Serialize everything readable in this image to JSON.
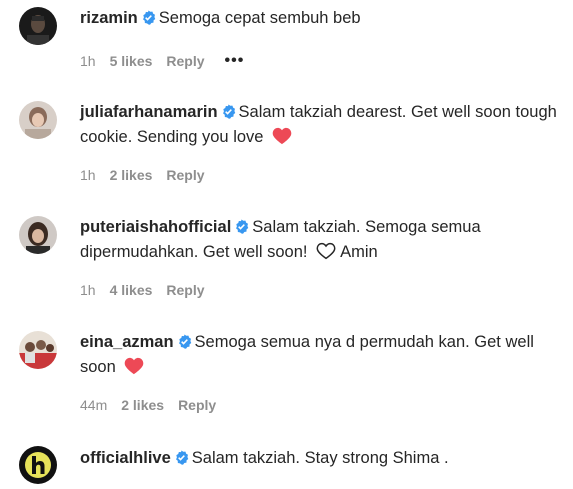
{
  "comments": [
    {
      "username": "rizamin",
      "text_before": "Semoga cepat sembuh beb",
      "text_after": "",
      "time": "1h",
      "likes": "5 likes",
      "reply": "Reply",
      "more": "•••"
    },
    {
      "username": "juliafarhanamarin",
      "text_before": "Salam takziah dearest. Get well soon tough cookie. Sending you love",
      "text_after": "",
      "time": "1h",
      "likes": "2 likes",
      "reply": "Reply",
      "heart": "red"
    },
    {
      "username": "puteriaishahofficial",
      "text_before": "Salam takziah. Semoga semua dipermudahkan. Get well soon!",
      "text_after": "Amin",
      "time": "1h",
      "likes": "4 likes",
      "reply": "Reply",
      "heart": "outline"
    },
    {
      "username": "eina_azman",
      "text_before": "Semoga semua nya d permudah kan. Get well soon",
      "text_after": "",
      "time": "44m",
      "likes": "2 likes",
      "reply": "Reply",
      "heart": "red"
    },
    {
      "username": "officialhlive",
      "text_before": "Salam takziah. Stay strong Shima .",
      "text_after": ""
    }
  ],
  "colors": {
    "text": "#262626",
    "meta": "#8e8e8e",
    "verified": "#3897f0",
    "heart_red": "#ed4956"
  },
  "icons": {
    "verified": "verified-badge-icon",
    "heart": "heart-icon",
    "more": "more-options-icon"
  }
}
